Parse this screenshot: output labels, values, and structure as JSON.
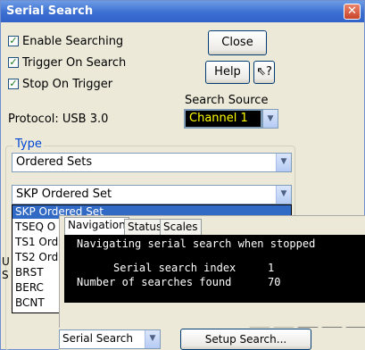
{
  "window": {
    "title": "Serial Search",
    "close_glyph": "✕"
  },
  "options": [
    {
      "label": "Enable Searching",
      "checked": true
    },
    {
      "label": "Trigger On Search",
      "checked": true
    },
    {
      "label": "Stop On Trigger",
      "checked": true
    }
  ],
  "buttons": {
    "close": "Close",
    "help": "Help",
    "whats_this": "⇖?"
  },
  "protocol_label": "Protocol: USB 3.0",
  "search_source": {
    "label": "Search Source",
    "value": "Channel 1",
    "value_color": "#ffff00"
  },
  "type_group": {
    "legend": "Type",
    "type_value": "Ordered Sets",
    "kind_value": "SKP Ordered Set",
    "list": [
      "SKP Ordered Set",
      "TSEQ O",
      "TS1 Ord",
      "TS2 Ord",
      "BRST",
      "BERC",
      "BCNT"
    ],
    "selected_index": 0
  },
  "hidden_edges": {
    "u": "U",
    "s": "S"
  },
  "panel": {
    "tabs": [
      "Navigation",
      "Status",
      "Scales"
    ],
    "active_tab": 0,
    "lines": {
      "status": "Navigating serial search when stopped",
      "index_label": "Serial search index",
      "index_value": "1",
      "count_label": "Number of searches found",
      "count_value": "70"
    },
    "nav_buttons": [
      "⏮",
      "◀",
      "▼",
      "▶",
      ""
    ],
    "mode_value": "Serial Search",
    "setup_button": "Setup Search..."
  },
  "colors": {
    "title_bar": "#3b6fd0",
    "selection": "#316ac5",
    "terminal_bg": "#000000"
  },
  "icons": {
    "dropdown": "chevron-down-icon",
    "checkbox": "checkmark-icon"
  }
}
